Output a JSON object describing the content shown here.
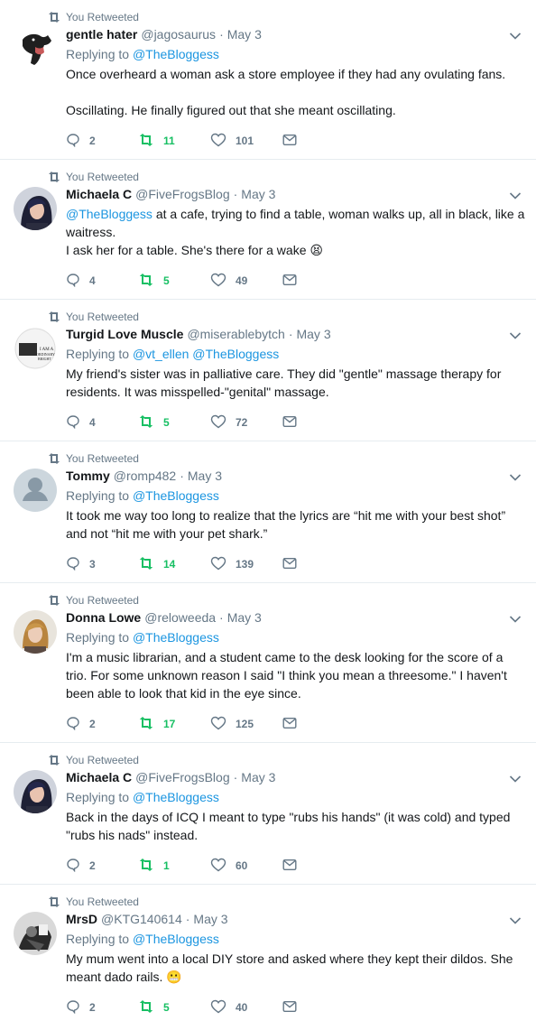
{
  "retweet_label": "You Retweeted",
  "replying_label": "Replying to",
  "colors": {
    "link": "#1b95e0",
    "retweet_green": "#17bf63",
    "muted": "#657786",
    "divider": "#e6ecf0"
  },
  "tweets": [
    {
      "name": "gentle hater",
      "handle": "@jagosaurus",
      "date": "May 3",
      "replying_to": [
        "@TheBloggess"
      ],
      "mention_lead": "",
      "text": "Once overheard a woman ask a store employee if they had any ovulating fans.\n\nOscillating. He finally figured out that she meant oscillating.",
      "replies": "2",
      "retweets": "11",
      "likes": "101"
    },
    {
      "name": "Michaela C",
      "handle": "@FiveFrogsBlog",
      "date": "May 3",
      "replying_to": [],
      "mention_lead": "@TheBloggess",
      "text": " at a cafe, trying to find a table, woman walks up, all in black, like a waitress.\nI ask her for a table. She's there for a wake 😫",
      "replies": "4",
      "retweets": "5",
      "likes": "49"
    },
    {
      "name": "Turgid Love Muscle",
      "handle": "@miserablebytch",
      "date": "May 3",
      "replying_to": [
        "@vt_ellen",
        "@TheBloggess"
      ],
      "mention_lead": "",
      "text": "My friend's sister was in palliative care. They did \"gentle\" massage therapy for residents. It was misspelled-\"genital\" massage.",
      "replies": "4",
      "retweets": "5",
      "likes": "72"
    },
    {
      "name": "Tommy",
      "handle": "@romp482",
      "date": "May 3",
      "replying_to": [
        "@TheBloggess"
      ],
      "mention_lead": "",
      "text": "It took me way too long to realize that the lyrics are “hit me with your best shot” and not “hit me with your pet shark.”",
      "replies": "3",
      "retweets": "14",
      "likes": "139"
    },
    {
      "name": "Donna Lowe",
      "handle": "@reloweeda",
      "date": "May 3",
      "replying_to": [
        "@TheBloggess"
      ],
      "mention_lead": "",
      "text": "I'm a music librarian, and a student came to the desk looking for the score of a trio. For some unknown reason I said \"I think you mean a threesome.\" I haven't been able to look that kid in the eye since.",
      "replies": "2",
      "retweets": "17",
      "likes": "125"
    },
    {
      "name": "Michaela C",
      "handle": "@FiveFrogsBlog",
      "date": "May 3",
      "replying_to": [
        "@TheBloggess"
      ],
      "mention_lead": "",
      "text": "Back in the days of ICQ I meant to type \"rubs his hands\" (it was cold) and typed \"rubs his nads\" instead.",
      "replies": "2",
      "retweets": "1",
      "likes": "60"
    },
    {
      "name": "MrsD",
      "handle": "@KTG140614",
      "date": "May 3",
      "replying_to": [
        "@TheBloggess"
      ],
      "mention_lead": "",
      "text": "My mum went into a local DIY store and asked where they kept their dildos. She meant dado rails. 😬",
      "replies": "2",
      "retweets": "5",
      "likes": "40"
    }
  ],
  "avatars": [
    "dog-avatar",
    "woman-dark-hair-avatar",
    "badge-logo-avatar",
    "default-avatar",
    "woman-blonde-avatar",
    "woman-dark-hair-avatar",
    "bw-photo-avatar"
  ]
}
